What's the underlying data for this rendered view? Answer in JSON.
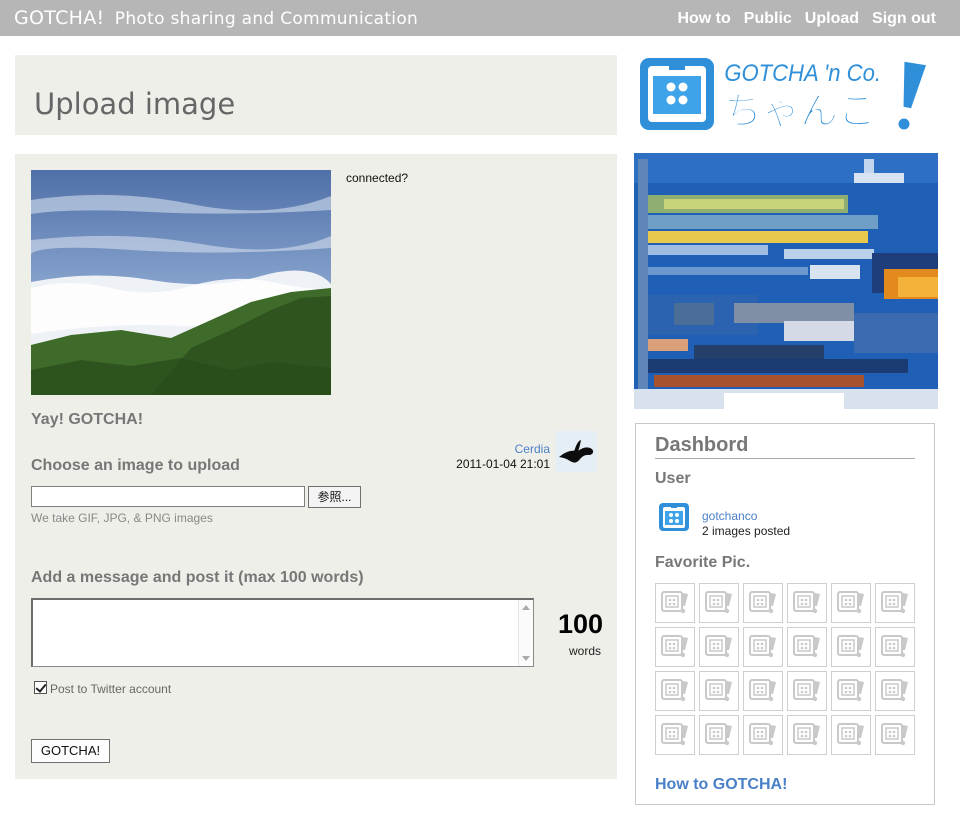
{
  "header": {
    "brand": "GOTCHA!",
    "tagline": "Photo sharing and Communication",
    "nav": [
      "How to",
      "Public",
      "Upload",
      "Sign out"
    ]
  },
  "page_title": "Upload image",
  "main": {
    "connected_text": "connected?",
    "yay_text": "Yay! GOTCHA!",
    "poster": {
      "name": "Cerdia",
      "datetime": "2011-01-04 21:01"
    },
    "choose_label": "Choose an image to upload",
    "file_value": "",
    "browse_label": "参照...",
    "formats_hint": "We take GIF, JPG, & PNG images",
    "message_label": "Add a message and post it (max 100 words)",
    "message_value": "",
    "word_count": "100",
    "word_unit": "words",
    "twitter_checked": true,
    "twitter_label": "Post to Twitter account",
    "submit_label": "GOTCHA!"
  },
  "logo": {
    "english": "GOTCHA 'n Co.",
    "japanese": "ちゃんこ",
    "mark": "!"
  },
  "dashboard": {
    "title": "Dashbord",
    "user_heading": "User",
    "username": "gotchanco",
    "images_posted": "2 images posted",
    "favorites_heading": "Favorite Pic.",
    "favorites_count": 24,
    "howto_link": "How to GOTCHA!"
  },
  "colors": {
    "accent": "#3ea3e8",
    "link": "#4a80c8",
    "panel": "#efefea",
    "topbar": "#b6b6b6"
  }
}
